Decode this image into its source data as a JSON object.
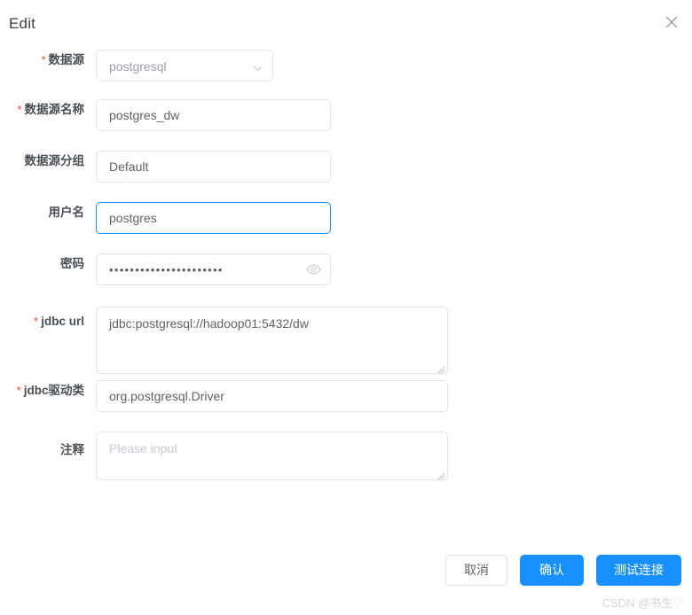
{
  "dialog": {
    "title": "Edit",
    "close_icon": "close-icon"
  },
  "form": {
    "fields": [
      {
        "label": "数据源",
        "required": true,
        "type": "select",
        "value": "postgresql",
        "icon": "chevron-down-icon"
      },
      {
        "label": "数据源名称",
        "required": true,
        "type": "input",
        "value": "postgres_dw",
        "placeholder": "Please input"
      },
      {
        "label": "数据源分组",
        "required": false,
        "type": "input",
        "value": "Default",
        "placeholder": "Please input"
      },
      {
        "label": "用户名",
        "required": false,
        "type": "input",
        "value": "postgres",
        "placeholder": "Please input",
        "focused": true
      },
      {
        "label": "密码",
        "required": false,
        "type": "password",
        "value": "••••••••••••••••••••••",
        "placeholder": "Please input",
        "icon": "eye-icon"
      },
      {
        "label": "jdbc url",
        "required": true,
        "type": "textarea",
        "value": "jdbc:postgresql://hadoop01:5432/dw",
        "placeholder": "Please input"
      },
      {
        "label": "jdbc驱动类",
        "required": true,
        "type": "input",
        "value": "org.postgresql.Driver",
        "placeholder": "Please input"
      },
      {
        "label": "注释",
        "required": false,
        "type": "textarea",
        "value": "",
        "placeholder": "Please input"
      }
    ]
  },
  "footer": {
    "cancel_label": "取消",
    "confirm_label": "确认",
    "test_label": "测试连接"
  },
  "watermark": "CSDN @书生♡",
  "colors": {
    "primary": "#1890ff",
    "required_star": "#f5483b",
    "border": "#e2e4e8",
    "text": "#4a4f57",
    "placeholder": "#c8ccd4"
  }
}
